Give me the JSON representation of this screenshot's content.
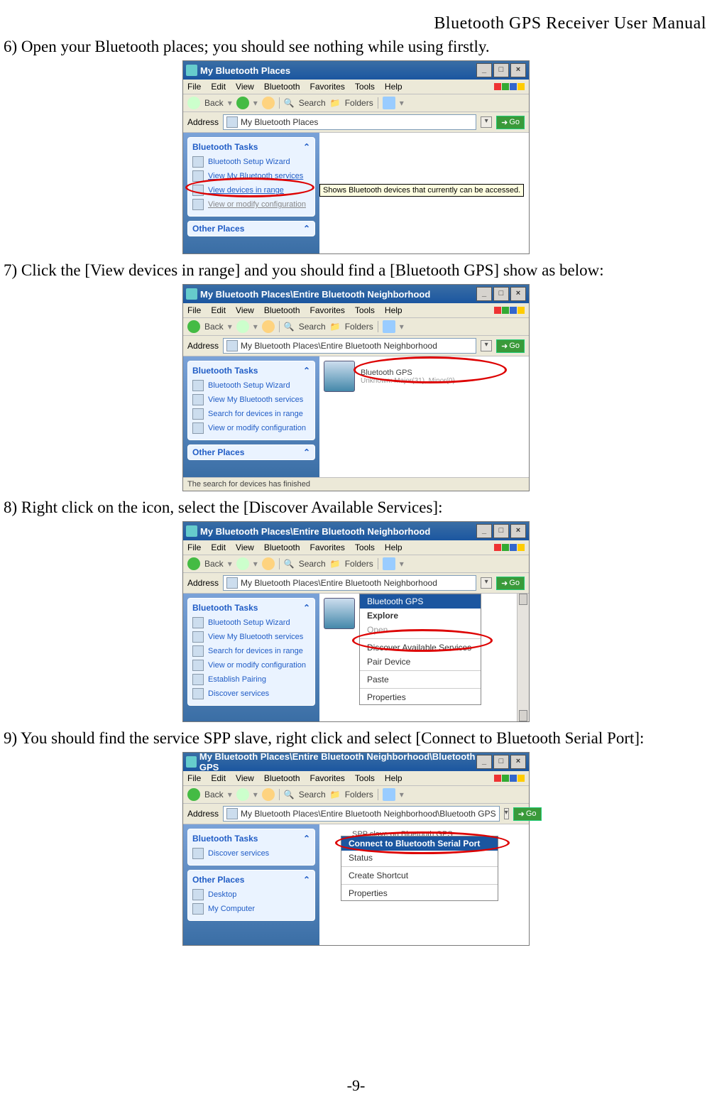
{
  "page": {
    "header_title": "Bluetooth  GPS  Receiver  User  Manual",
    "footer": "-9-",
    "step6": "6) Open your Bluetooth places; you should see nothing while using firstly.",
    "step7": "7) Click the [View devices in range] and you should find a [Bluetooth GPS] show as below:",
    "step8": "8) Right click on the icon, select the [Discover Available Services]:",
    "step9": "9) You should find the service SPP slave, right click and select [Connect to Bluetooth Serial Port]:"
  },
  "win1": {
    "title": "My Bluetooth Places",
    "menus": [
      "File",
      "Edit",
      "View",
      "Bluetooth",
      "Favorites",
      "Tools",
      "Help"
    ],
    "tb_back": "Back",
    "tb_search": "Search",
    "tb_folders": "Folders",
    "addr_label": "Address",
    "addr_value": "My Bluetooth Places",
    "go": "Go",
    "panel_title": "Bluetooth Tasks",
    "task1": "Bluetooth Setup Wizard",
    "task2": "View My Bluetooth services",
    "task3": "View devices in range",
    "task4": "View or modify configuration",
    "other": "Other Places",
    "tooltip": "Shows Bluetooth devices that currently can be accessed."
  },
  "win2": {
    "title": "My Bluetooth Places\\Entire Bluetooth Neighborhood",
    "menus": [
      "File",
      "Edit",
      "View",
      "Bluetooth",
      "Favorites",
      "Tools",
      "Help"
    ],
    "tb_back": "Back",
    "tb_search": "Search",
    "tb_folders": "Folders",
    "addr_label": "Address",
    "addr_value": "My Bluetooth Places\\Entire Bluetooth Neighborhood",
    "go": "Go",
    "panel_title": "Bluetooth Tasks",
    "task1": "Bluetooth Setup Wizard",
    "task2": "View My Bluetooth services",
    "task3": "Search for devices in range",
    "task4": "View or modify configuration",
    "other": "Other Places",
    "device_name": "Bluetooth GPS",
    "device_sub": "Unknown: Major(31), Minor(0)",
    "status": "The search for devices has finished"
  },
  "win3": {
    "title": "My Bluetooth Places\\Entire Bluetooth Neighborhood",
    "menus": [
      "File",
      "Edit",
      "View",
      "Bluetooth",
      "Favorites",
      "Tools",
      "Help"
    ],
    "tb_back": "Back",
    "tb_search": "Search",
    "tb_folders": "Folders",
    "addr_label": "Address",
    "addr_value": "My Bluetooth Places\\Entire Bluetooth Neighborhood",
    "go": "Go",
    "panel_title": "Bluetooth Tasks",
    "task1": "Bluetooth Setup Wizard",
    "task2": "View My Bluetooth services",
    "task3": "Search for devices in range",
    "task4": "View or modify configuration",
    "task5": "Establish Pairing",
    "task6": "Discover services",
    "ctx_hd": "Bluetooth GPS",
    "ctx_explore": "Explore",
    "ctx_open": "Open",
    "ctx_discover": "Discover Available Services",
    "ctx_pair": "Pair Device",
    "ctx_paste": "Paste",
    "ctx_props": "Properties"
  },
  "win4": {
    "title": "My Bluetooth Places\\Entire Bluetooth Neighborhood\\Bluetooth GPS",
    "menus": [
      "File",
      "Edit",
      "View",
      "Bluetooth",
      "Favorites",
      "Tools",
      "Help"
    ],
    "tb_back": "Back",
    "tb_search": "Search",
    "tb_folders": "Folders",
    "addr_label": "Address",
    "addr_value": "My Bluetooth Places\\Entire Bluetooth Neighborhood\\Bluetooth GPS",
    "go": "Go",
    "panel_title": "Bluetooth Tasks",
    "task1": "Discover services",
    "other_title": "Other Places",
    "other1": "Desktop",
    "other2": "My Computer",
    "svc_name": "SPP slave on Bluetooth GPS",
    "ctx_connect": "Connect to Bluetooth Serial Port",
    "ctx_status": "Status",
    "ctx_shortcut": "Create Shortcut",
    "ctx_props": "Properties"
  }
}
